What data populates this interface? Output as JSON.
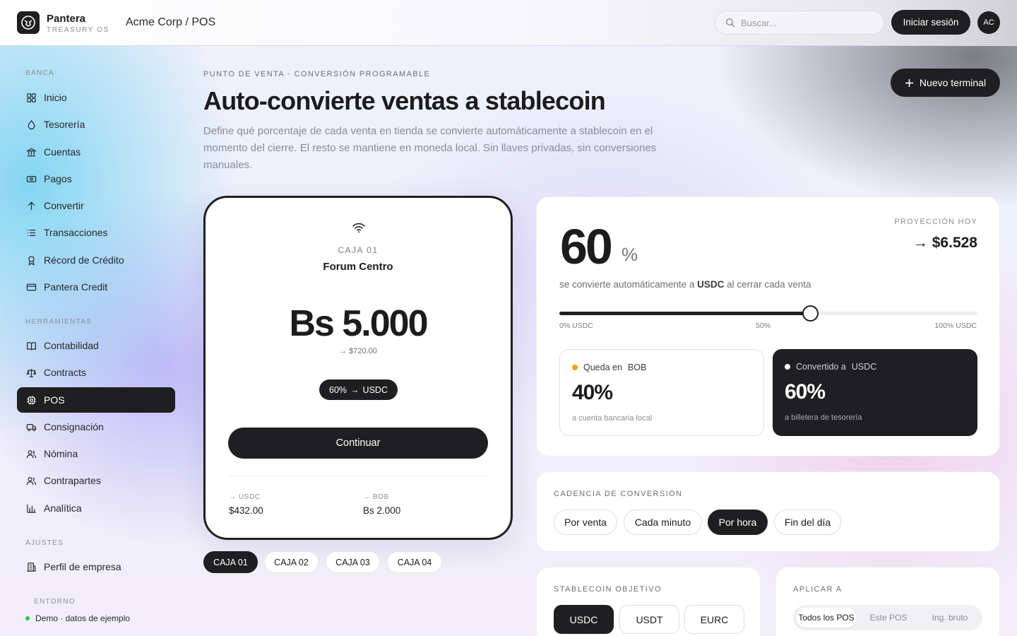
{
  "app": {
    "name": "Pantera",
    "subtitle": "TREASURY OS",
    "breadcrumb": "Acme Corp / POS"
  },
  "topbar": {
    "search_placeholder": "Buscar...",
    "login_label": "Iniciar sesión",
    "avatar_initials": "AC"
  },
  "sidebar": {
    "section_banca": "BANCA",
    "banca_items": [
      {
        "label": "Inicio",
        "icon": "grid-icon"
      },
      {
        "label": "Tesorería",
        "icon": "drop-icon"
      },
      {
        "label": "Cuentas",
        "icon": "bank-icon"
      },
      {
        "label": "Pagos",
        "icon": "banknote-icon"
      },
      {
        "label": "Convertir",
        "icon": "arrow-up-icon"
      },
      {
        "label": "Transacciones",
        "icon": "list-icon"
      },
      {
        "label": "Récord de Crédito",
        "icon": "award-icon"
      },
      {
        "label": "Pantera Credit",
        "icon": "card-icon"
      }
    ],
    "section_herramientas": "HERRAMIENTAS",
    "herramientas_items": [
      {
        "label": "Contabilidad",
        "icon": "book-icon"
      },
      {
        "label": "Contracts",
        "icon": "scale-icon"
      },
      {
        "label": "POS",
        "icon": "chip-icon",
        "active": true
      },
      {
        "label": "Consignación",
        "icon": "truck-icon"
      },
      {
        "label": "Nómina",
        "icon": "users-icon"
      },
      {
        "label": "Contrapartes",
        "icon": "user-group-icon"
      },
      {
        "label": "Analítica",
        "icon": "bar-chart-icon"
      }
    ],
    "section_ajustes": "AJUSTES",
    "ajustes_items": [
      {
        "label": "Perfil de empresa",
        "icon": "building-icon"
      }
    ],
    "section_entorno": "ENTORNO",
    "env_text": "Demo · datos de ejemplo"
  },
  "header": {
    "eyebrow": "PUNTO DE VENTA · CONVERSIÓN PROGRAMABLE",
    "title": "Auto-convierte ventas a stablecoin",
    "description": "Define qué porcentaje de cada venta en tienda se convierte automáticamente a stablecoin en el momento del cierre. El resto se mantiene en moneda local. Sin llaves privadas, sin conversiones manuales.",
    "new_terminal_label": "Nuevo terminal"
  },
  "pos": {
    "caja": "CAJA 01",
    "store": "Forum Centro",
    "amount": "Bs 5.000",
    "converted": "→ $720.00",
    "chip_pct": "60%",
    "chip_arrow": "→",
    "chip_coin": "USDC",
    "continue_label": "Continuar",
    "split": [
      {
        "label": "→ USDC",
        "value": "$432.00"
      },
      {
        "label": "→ BOB",
        "value": "Bs 2.000"
      }
    ],
    "tabs": [
      "CAJA 01",
      "CAJA 02",
      "CAJA 03",
      "CAJA 04"
    ]
  },
  "conversion": {
    "percent": "60",
    "percent_symbol": "%",
    "percent_value": 0.6,
    "projection_label": "PROYECCIÓN HOY",
    "projection_value": "→ $6.528",
    "desc_prefix": "se convierte automáticamente a",
    "desc_coin": "USDC",
    "desc_suffix": "al cerrar cada venta",
    "tick_min": "0% USDC",
    "tick_mid": "50%",
    "tick_max": "100% USDC",
    "local": {
      "label": "Queda en",
      "currency": "BOB",
      "pct": "40%",
      "sub": "a cuenta bancaria local",
      "dot_color": "#f59e0b"
    },
    "stable": {
      "label": "Convertido a",
      "currency": "USDC",
      "pct": "60%",
      "sub": "a billetera de tesorería",
      "dot_color": "#ffffff"
    }
  },
  "cadence": {
    "label": "CADENCIA DE CONVERSIÓN",
    "options": [
      "Por venta",
      "Cada minuto",
      "Por hora",
      "Fin del día"
    ],
    "selected": "Por hora"
  },
  "stablecoin": {
    "label": "STABLECOIN OBJETIVO",
    "options": [
      "USDC",
      "USDT",
      "EURC"
    ],
    "selected": "USDC"
  },
  "apply": {
    "label": "APLICAR A",
    "options": [
      "Todos los POS",
      "Este POS",
      "Ing. bruto"
    ],
    "selected": "Todos los POS"
  }
}
